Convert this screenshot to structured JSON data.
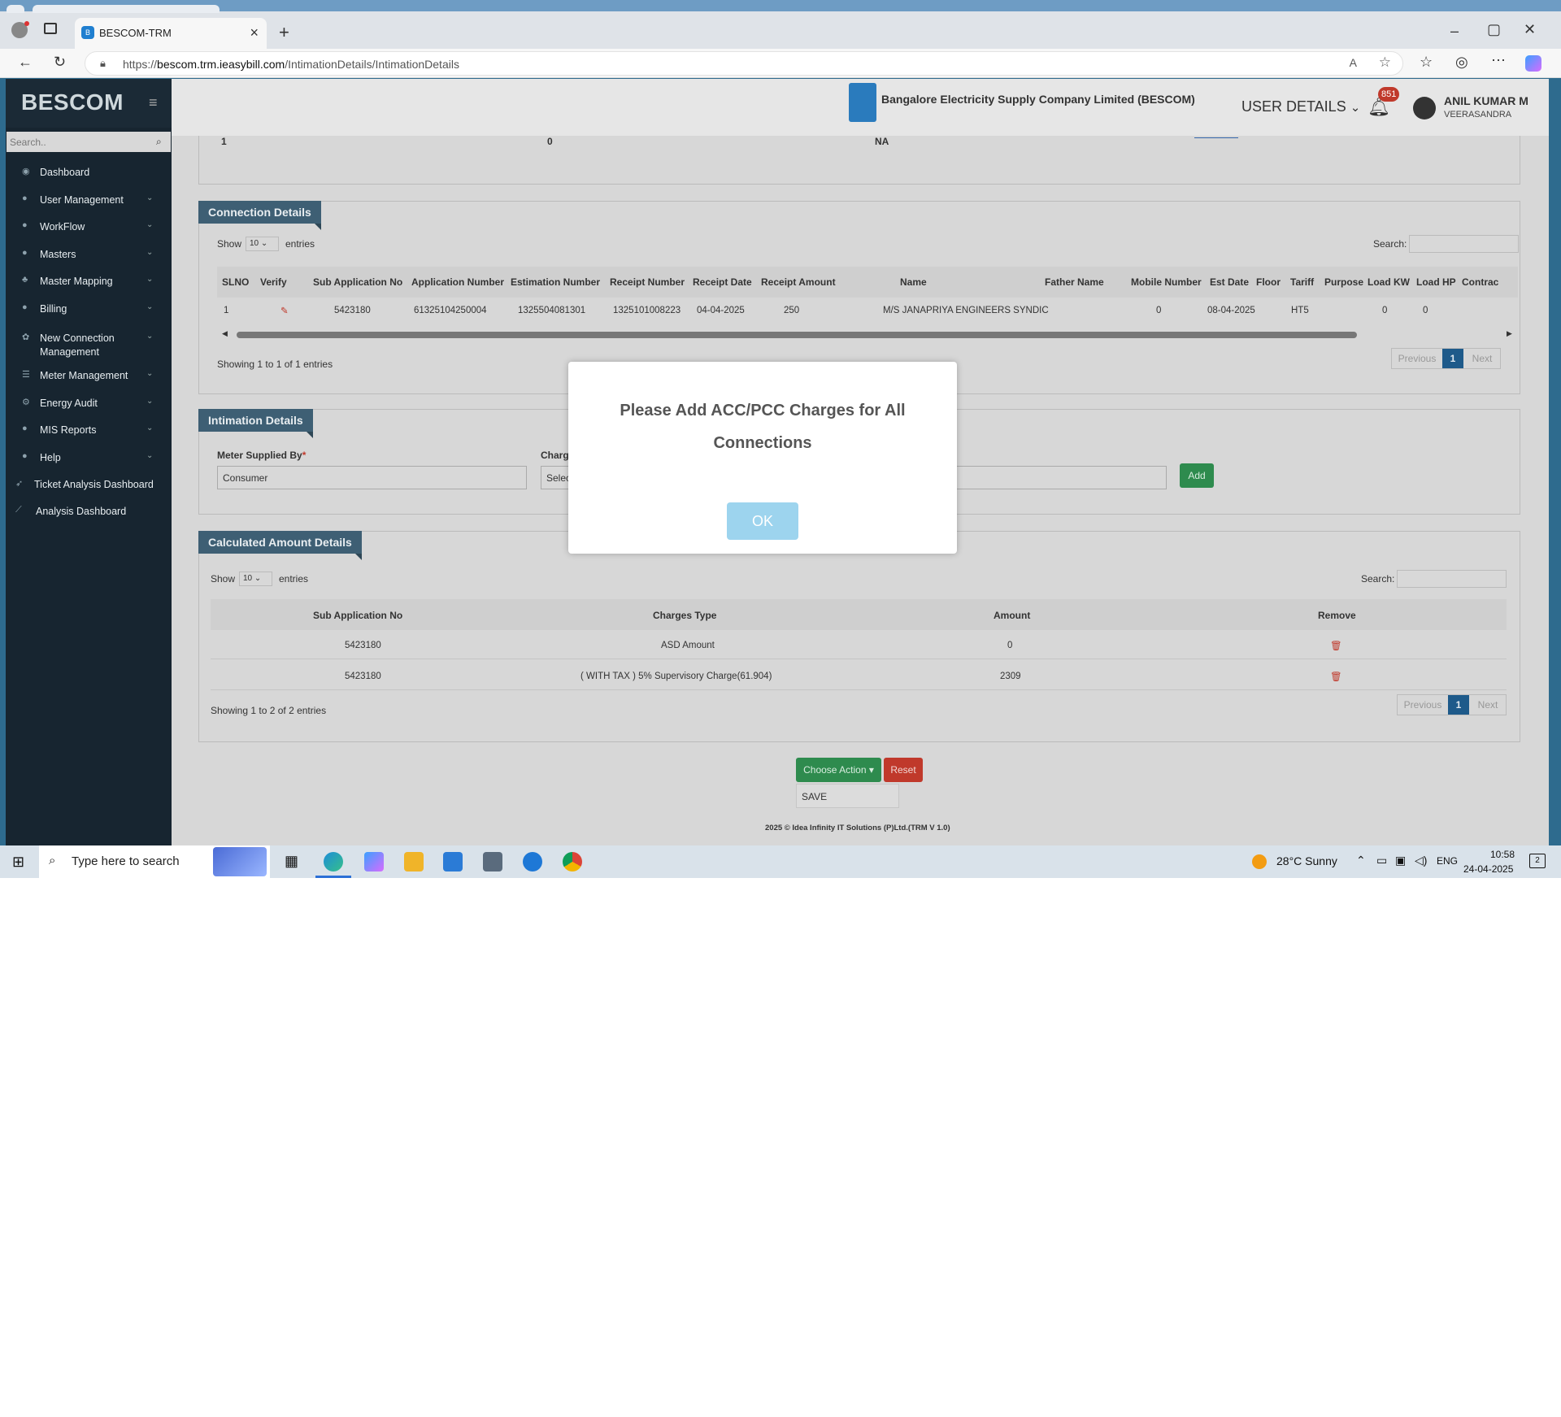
{
  "browser": {
    "tab_title": "BESCOM-TRM",
    "url_prefix": "https://",
    "url_host": "bescom.trm.ieasybill.com",
    "url_path": "/IntimationDetails/IntimationDetails"
  },
  "sidebar": {
    "brand": "BESCOM",
    "search_placeholder": "Search..",
    "items": [
      {
        "label": "Dashboard",
        "icon": "dashboard-icon",
        "chev": ""
      },
      {
        "label": "User Management",
        "icon": "user-icon",
        "chev": "⌄"
      },
      {
        "label": "WorkFlow",
        "icon": "user-icon",
        "chev": "⌄"
      },
      {
        "label": "Masters",
        "icon": "user-icon",
        "chev": "⌄"
      },
      {
        "label": "Master Mapping",
        "icon": "sitemap-icon",
        "chev": "⌄"
      },
      {
        "label": "Billing",
        "icon": "user-icon",
        "chev": "⌄"
      },
      {
        "label": "New Connection\nManagement",
        "icon": "gear-icon",
        "chev": "⌄"
      },
      {
        "label": "Meter Management",
        "icon": "list-icon",
        "chev": "⌄"
      },
      {
        "label": "Energy Audit",
        "icon": "chart-icon",
        "chev": "⌄"
      },
      {
        "label": "MIS Reports",
        "icon": "user-icon",
        "chev": "⌄"
      },
      {
        "label": "Help",
        "icon": "user-icon",
        "chev": "⌄"
      },
      {
        "label": "Ticket Analysis Dashboard",
        "icon": "rocket-icon",
        "chev": ""
      },
      {
        "label": "Analysis Dashboard",
        "icon": "line-chart-icon",
        "chev": ""
      }
    ]
  },
  "header": {
    "company": "Bangalore Electricity Supply Company Limited (BESCOM)",
    "user_details": "USER DETAILS",
    "notif_count": "851",
    "user_name": "ANIL KUMAR M",
    "user_location": "VEERASANDRA"
  },
  "top_strip": {
    "c1": "1",
    "c2": "0",
    "c3": "NA"
  },
  "connection": {
    "title": "Connection Details",
    "show": "Show",
    "entries_value": "10",
    "entries": "entries",
    "search": "Search:",
    "headers": [
      "SLNO",
      "Verify",
      "Sub Application No",
      "Application Number",
      "Estimation Number",
      "Receipt Number",
      "Receipt Date",
      "Receipt Amount",
      "Name",
      "Father Name",
      "Mobile Number",
      "Est Date",
      "Floor",
      "Tariff",
      "Purpose",
      "Load KW",
      "Load HP",
      "Contrac"
    ],
    "row": [
      "1",
      "",
      "5423180",
      "61325104250004",
      "1325504081301",
      "1325101008223",
      "04-04-2025",
      "250",
      "M/S JANAPRIYA ENGINEERS SYNDIC",
      "",
      "0",
      "08-04-2025",
      "",
      "HT5",
      "",
      "0",
      "0",
      ""
    ],
    "showing": "Showing 1 to 1 of 1 entries",
    "prev": "Previous",
    "page": "1",
    "next": "Next"
  },
  "intimation": {
    "title": "Intimation Details",
    "meter_label": "Meter Supplied By",
    "required": "*",
    "meter_value": "Consumer",
    "charge_label": "Charg",
    "charge_value": "Selec",
    "add": "Add"
  },
  "calculated": {
    "title": "Calculated Amount Details",
    "show": "Show",
    "entries_value": "10",
    "entries": "entries",
    "search": "Search:",
    "headers": [
      "Sub Application No",
      "Charges Type",
      "Amount",
      "Remove"
    ],
    "rows": [
      {
        "sub": "5423180",
        "type": "ASD Amount",
        "amount": "0"
      },
      {
        "sub": "5423180",
        "type": "( WITH TAX ) 5% Supervisory Charge(61.904)",
        "amount": "2309"
      }
    ],
    "showing": "Showing 1 to 2 of 2 entries",
    "prev": "Previous",
    "page": "1",
    "next": "Next"
  },
  "actions": {
    "choose": "Choose Action",
    "reset": "Reset",
    "save": "SAVE"
  },
  "footer": "2025 © Idea Infinity IT Solutions (P)Ltd.(TRM V 1.0)",
  "modal": {
    "message": "Please Add ACC/PCC Charges for All Connections",
    "ok": "OK"
  },
  "taskbar": {
    "search_placeholder": "Type here to search",
    "weather": "28°C  Sunny",
    "lang": "ENG",
    "time": "10:58",
    "date": "24-04-2025",
    "notif": "2"
  },
  "colors": {
    "sidebar": "#172530",
    "panel_tag": "#3e5f74",
    "green": "#2e8b4e",
    "red": "#c0392b",
    "ok": "#9dd4ee"
  }
}
